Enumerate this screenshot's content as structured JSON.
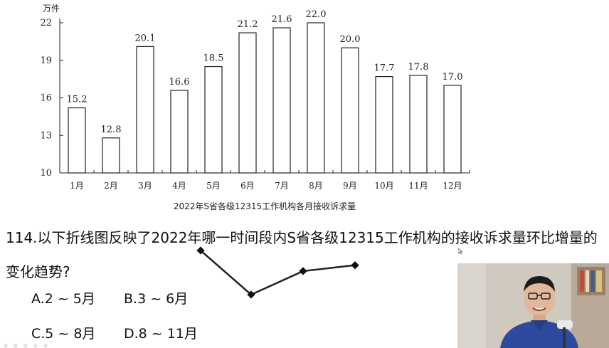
{
  "chart_data": {
    "type": "bar",
    "unit_label": "万件",
    "title": "2022年S省各级12315工作机构各月接收诉求量",
    "categories": [
      "1月",
      "2月",
      "3月",
      "4月",
      "5月",
      "6月",
      "7月",
      "8月",
      "9月",
      "10月",
      "11月",
      "12月"
    ],
    "values": [
      15.2,
      12.8,
      20.1,
      16.6,
      18.5,
      21.2,
      21.6,
      22.0,
      20.0,
      17.7,
      17.8,
      17.0
    ],
    "value_labels": [
      "15.2",
      "12.8",
      "20.1",
      "16.6",
      "18.5",
      "21.2",
      "21.6",
      "22.0",
      "20.0",
      "17.7",
      "17.8",
      "17.0"
    ],
    "y_ticks": [
      10,
      13,
      16,
      19,
      22
    ],
    "ylim": [
      10,
      22
    ],
    "grid": false
  },
  "question": {
    "line1": "114.以下折线图反映了2022年哪一时间段内S省各级12315工作机构的接收诉求量环比增量的",
    "line2": "变化趋势?",
    "options": {
      "a": "A.2 ~ 5月",
      "b": "B.3 ~ 6月",
      "c": "C.5 ~ 8月",
      "d": "D.8 ~ 11月"
    }
  },
  "mini_chart": {
    "type": "line",
    "shape_values": [
      3,
      0,
      1.6,
      2.0
    ]
  }
}
